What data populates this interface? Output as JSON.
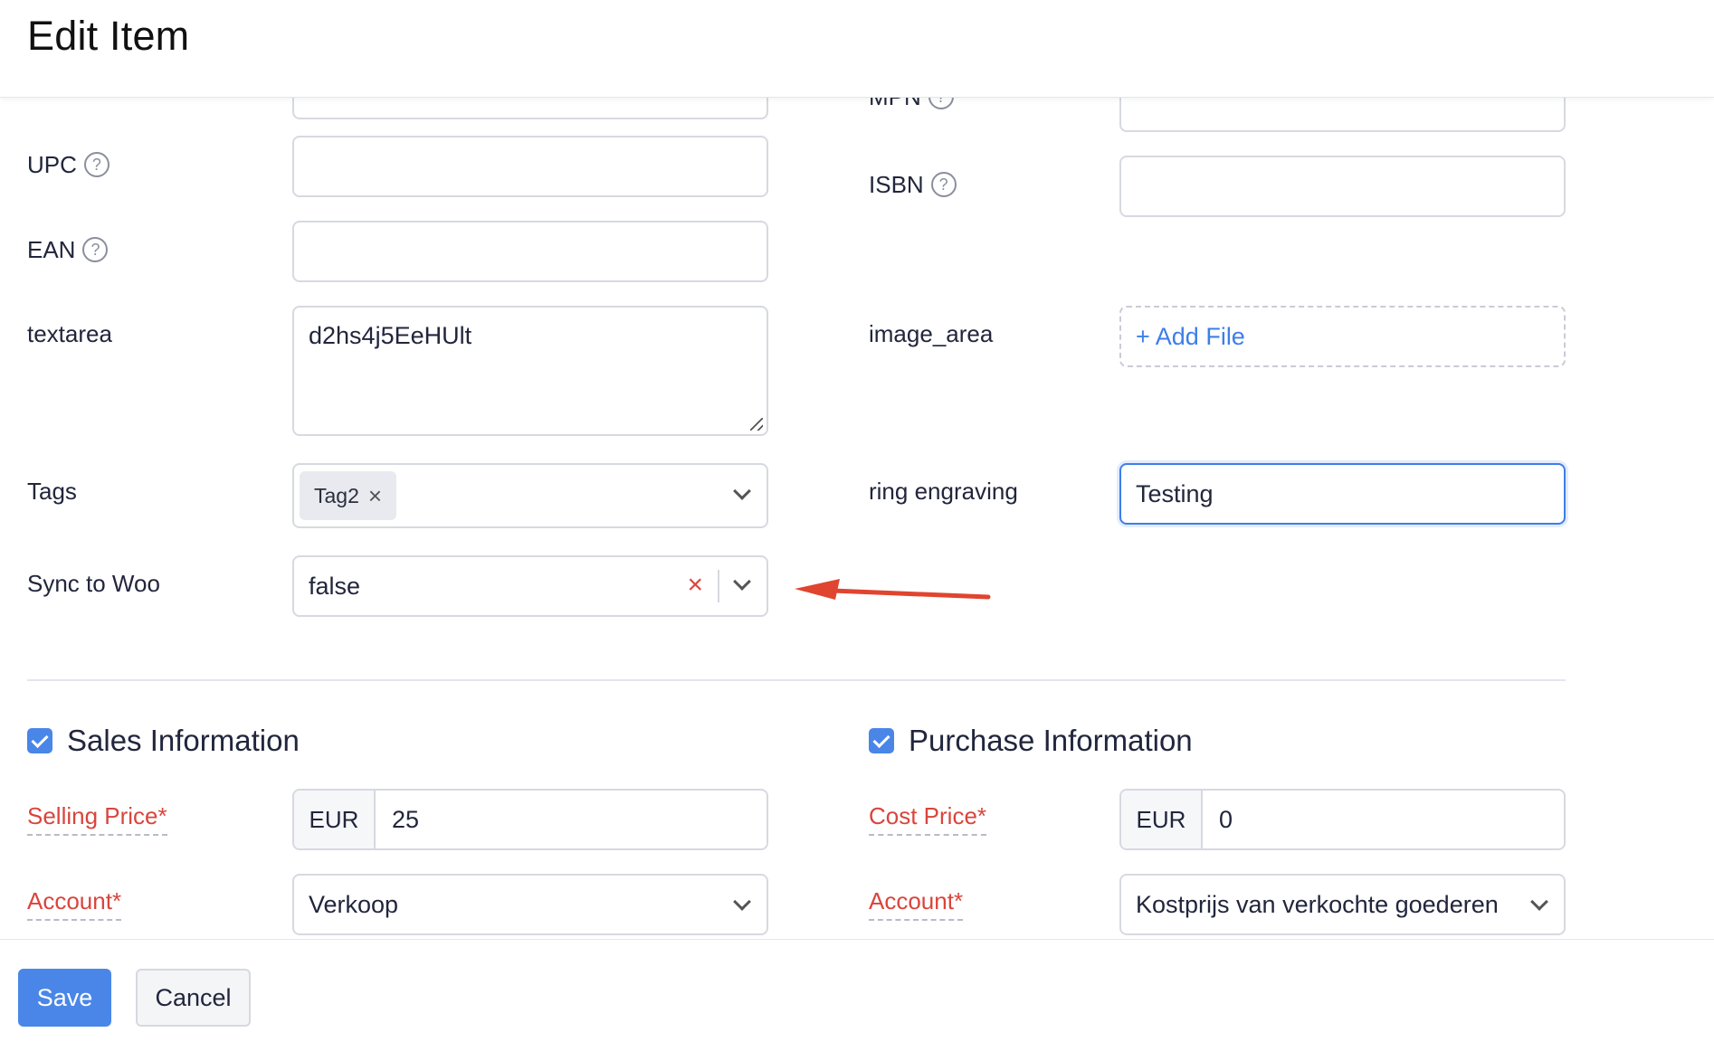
{
  "header": {
    "title": "Edit Item"
  },
  "left_fields": {
    "upc_label": "UPC",
    "ean_label": "EAN",
    "textarea_label": "textarea",
    "textarea_value": "d2hs4j5EeHUlt",
    "tags_label": "Tags",
    "tag_chip": "Tag2",
    "sync_label": "Sync to Woo",
    "sync_value": "false"
  },
  "right_fields": {
    "mpn_label": "MPN",
    "isbn_label": "ISBN",
    "image_area_label": "image_area",
    "add_file": "+ Add File",
    "ring_engraving_label": "ring engraving",
    "ring_engraving_value": "Testing"
  },
  "sales": {
    "title": "Sales Information",
    "checked": true,
    "selling_price_label": "Selling Price*",
    "currency": "EUR",
    "selling_price_value": "25",
    "account_label": "Account*",
    "account_value": "Verkoop"
  },
  "purchase": {
    "title": "Purchase Information",
    "checked": true,
    "cost_price_label": "Cost Price*",
    "currency": "EUR",
    "cost_price_value": "0",
    "account_label": "Account*",
    "account_value": "Kostprijs van verkochte goederen"
  },
  "footer": {
    "save_label": "Save",
    "cancel_label": "Cancel"
  },
  "colors": {
    "accent": "#4a86e8",
    "required": "#d9453c",
    "arrow": "#e0452f"
  },
  "icons": {
    "help": "question-circle-icon",
    "dropdown": "chevron-down-icon",
    "clear": "close-icon",
    "tag_remove": "close-icon"
  }
}
